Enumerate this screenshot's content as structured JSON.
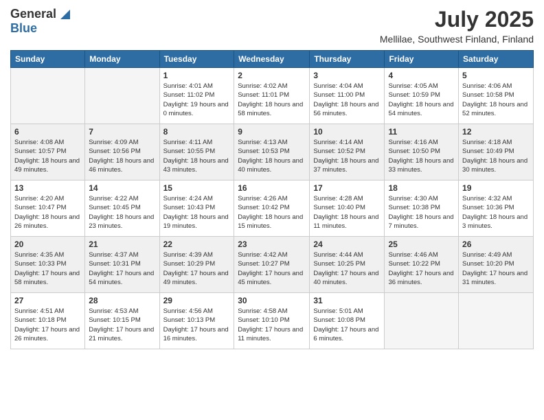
{
  "logo": {
    "general": "General",
    "blue": "Blue"
  },
  "header": {
    "month": "July 2025",
    "location": "Mellilae, Southwest Finland, Finland"
  },
  "weekdays": [
    "Sunday",
    "Monday",
    "Tuesday",
    "Wednesday",
    "Thursday",
    "Friday",
    "Saturday"
  ],
  "weeks": [
    [
      {
        "day": "",
        "info": ""
      },
      {
        "day": "",
        "info": ""
      },
      {
        "day": "1",
        "info": "Sunrise: 4:01 AM\nSunset: 11:02 PM\nDaylight: 19 hours\nand 0 minutes."
      },
      {
        "day": "2",
        "info": "Sunrise: 4:02 AM\nSunset: 11:01 PM\nDaylight: 18 hours\nand 58 minutes."
      },
      {
        "day": "3",
        "info": "Sunrise: 4:04 AM\nSunset: 11:00 PM\nDaylight: 18 hours\nand 56 minutes."
      },
      {
        "day": "4",
        "info": "Sunrise: 4:05 AM\nSunset: 10:59 PM\nDaylight: 18 hours\nand 54 minutes."
      },
      {
        "day": "5",
        "info": "Sunrise: 4:06 AM\nSunset: 10:58 PM\nDaylight: 18 hours\nand 52 minutes."
      }
    ],
    [
      {
        "day": "6",
        "info": "Sunrise: 4:08 AM\nSunset: 10:57 PM\nDaylight: 18 hours\nand 49 minutes."
      },
      {
        "day": "7",
        "info": "Sunrise: 4:09 AM\nSunset: 10:56 PM\nDaylight: 18 hours\nand 46 minutes."
      },
      {
        "day": "8",
        "info": "Sunrise: 4:11 AM\nSunset: 10:55 PM\nDaylight: 18 hours\nand 43 minutes."
      },
      {
        "day": "9",
        "info": "Sunrise: 4:13 AM\nSunset: 10:53 PM\nDaylight: 18 hours\nand 40 minutes."
      },
      {
        "day": "10",
        "info": "Sunrise: 4:14 AM\nSunset: 10:52 PM\nDaylight: 18 hours\nand 37 minutes."
      },
      {
        "day": "11",
        "info": "Sunrise: 4:16 AM\nSunset: 10:50 PM\nDaylight: 18 hours\nand 33 minutes."
      },
      {
        "day": "12",
        "info": "Sunrise: 4:18 AM\nSunset: 10:49 PM\nDaylight: 18 hours\nand 30 minutes."
      }
    ],
    [
      {
        "day": "13",
        "info": "Sunrise: 4:20 AM\nSunset: 10:47 PM\nDaylight: 18 hours\nand 26 minutes."
      },
      {
        "day": "14",
        "info": "Sunrise: 4:22 AM\nSunset: 10:45 PM\nDaylight: 18 hours\nand 23 minutes."
      },
      {
        "day": "15",
        "info": "Sunrise: 4:24 AM\nSunset: 10:43 PM\nDaylight: 18 hours\nand 19 minutes."
      },
      {
        "day": "16",
        "info": "Sunrise: 4:26 AM\nSunset: 10:42 PM\nDaylight: 18 hours\nand 15 minutes."
      },
      {
        "day": "17",
        "info": "Sunrise: 4:28 AM\nSunset: 10:40 PM\nDaylight: 18 hours\nand 11 minutes."
      },
      {
        "day": "18",
        "info": "Sunrise: 4:30 AM\nSunset: 10:38 PM\nDaylight: 18 hours\nand 7 minutes."
      },
      {
        "day": "19",
        "info": "Sunrise: 4:32 AM\nSunset: 10:36 PM\nDaylight: 18 hours\nand 3 minutes."
      }
    ],
    [
      {
        "day": "20",
        "info": "Sunrise: 4:35 AM\nSunset: 10:33 PM\nDaylight: 17 hours\nand 58 minutes."
      },
      {
        "day": "21",
        "info": "Sunrise: 4:37 AM\nSunset: 10:31 PM\nDaylight: 17 hours\nand 54 minutes."
      },
      {
        "day": "22",
        "info": "Sunrise: 4:39 AM\nSunset: 10:29 PM\nDaylight: 17 hours\nand 49 minutes."
      },
      {
        "day": "23",
        "info": "Sunrise: 4:42 AM\nSunset: 10:27 PM\nDaylight: 17 hours\nand 45 minutes."
      },
      {
        "day": "24",
        "info": "Sunrise: 4:44 AM\nSunset: 10:25 PM\nDaylight: 17 hours\nand 40 minutes."
      },
      {
        "day": "25",
        "info": "Sunrise: 4:46 AM\nSunset: 10:22 PM\nDaylight: 17 hours\nand 36 minutes."
      },
      {
        "day": "26",
        "info": "Sunrise: 4:49 AM\nSunset: 10:20 PM\nDaylight: 17 hours\nand 31 minutes."
      }
    ],
    [
      {
        "day": "27",
        "info": "Sunrise: 4:51 AM\nSunset: 10:18 PM\nDaylight: 17 hours\nand 26 minutes."
      },
      {
        "day": "28",
        "info": "Sunrise: 4:53 AM\nSunset: 10:15 PM\nDaylight: 17 hours\nand 21 minutes."
      },
      {
        "day": "29",
        "info": "Sunrise: 4:56 AM\nSunset: 10:13 PM\nDaylight: 17 hours\nand 16 minutes."
      },
      {
        "day": "30",
        "info": "Sunrise: 4:58 AM\nSunset: 10:10 PM\nDaylight: 17 hours\nand 11 minutes."
      },
      {
        "day": "31",
        "info": "Sunrise: 5:01 AM\nSunset: 10:08 PM\nDaylight: 17 hours\nand 6 minutes."
      },
      {
        "day": "",
        "info": ""
      },
      {
        "day": "",
        "info": ""
      }
    ]
  ]
}
